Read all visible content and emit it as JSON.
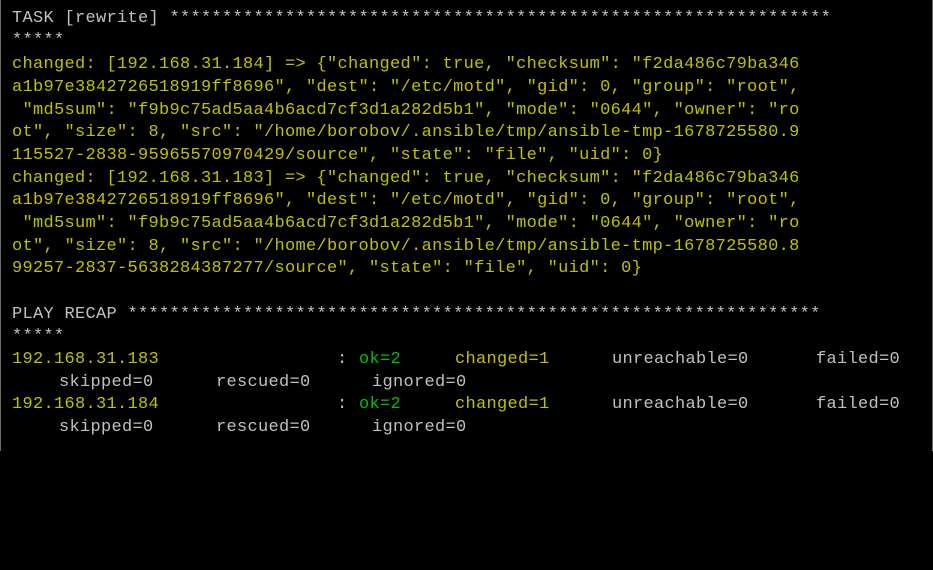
{
  "colors": {
    "background": "#000000",
    "default_text": "#c0c0c0",
    "changed_text": "#c0c000",
    "ok_text": "#00c000"
  },
  "task": {
    "header": "TASK [rewrite] ***************************************************************",
    "header_wrap": "*****"
  },
  "results": [
    {
      "lines": [
        "changed: [192.168.31.184] => {\"changed\": true, \"checksum\": \"f2da486c79ba346",
        "a1b97e3842726518919ff8696\", \"dest\": \"/etc/motd\", \"gid\": 0, \"group\": \"root\",",
        " \"md5sum\": \"f9b9c75ad5aa4b6acd7cf3d1a282d5b1\", \"mode\": \"0644\", \"owner\": \"ro",
        "ot\", \"size\": 8, \"src\": \"/home/borobov/.ansible/tmp/ansible-tmp-1678725580.9",
        "115527-2838-95965570970429/source\", \"state\": \"file\", \"uid\": 0}"
      ]
    },
    {
      "lines": [
        "changed: [192.168.31.183] => {\"changed\": true, \"checksum\": \"f2da486c79ba346",
        "a1b97e3842726518919ff8696\", \"dest\": \"/etc/motd\", \"gid\": 0, \"group\": \"root\",",
        " \"md5sum\": \"f9b9c75ad5aa4b6acd7cf3d1a282d5b1\", \"mode\": \"0644\", \"owner\": \"ro",
        "ot\", \"size\": 8, \"src\": \"/home/borobov/.ansible/tmp/ansible-tmp-1678725580.8",
        "99257-2837-5638284387277/source\", \"state\": \"file\", \"uid\": 0}"
      ]
    }
  ],
  "recap": {
    "header": "PLAY RECAP ******************************************************************",
    "header_wrap": "*****",
    "hosts": [
      {
        "host": "192.168.31.183",
        "colon": ":",
        "ok": "ok=2",
        "changed": "changed=1",
        "unreachable": "unreachable=0",
        "failed": "failed=0",
        "skipped": "skipped=0",
        "rescued": "rescued=0",
        "ignored": "ignored=0"
      },
      {
        "host": "192.168.31.184",
        "colon": ":",
        "ok": "ok=2",
        "changed": "changed=1",
        "unreachable": "unreachable=0",
        "failed": "failed=0",
        "skipped": "skipped=0",
        "rescued": "rescued=0",
        "ignored": "ignored=0"
      }
    ]
  }
}
